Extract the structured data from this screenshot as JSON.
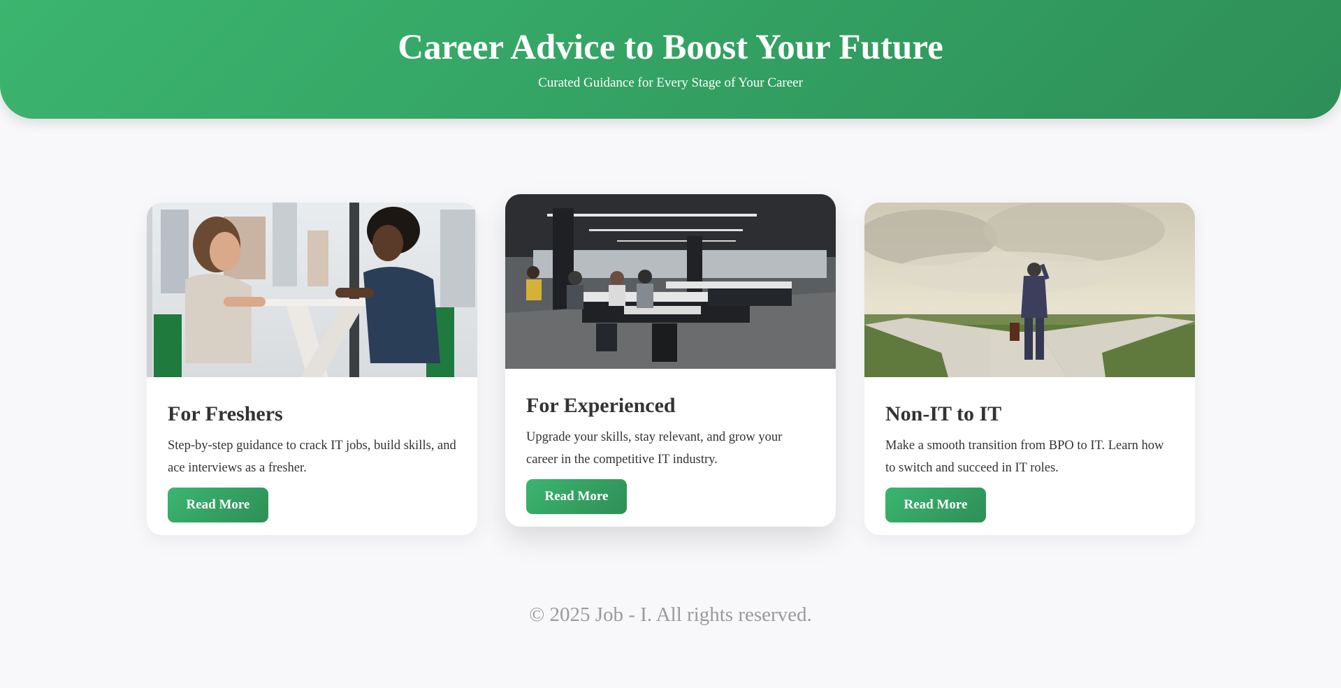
{
  "hero": {
    "title": "Career Advice to Boost Your Future",
    "subtitle": "Curated Guidance for Every Stage of Your Career",
    "gradient_start": "#3bb56f",
    "gradient_end": "#2e8f57"
  },
  "cards": [
    {
      "title": "For Freshers",
      "description": "Step-by-step guidance to crack IT jobs, build skills, and ace interviews as a fresher.",
      "button_label": "Read More",
      "image": "two-women-interview-photo"
    },
    {
      "title": "For Experienced",
      "description": "Upgrade your skills, stay relevant, and grow your career in the competitive IT industry.",
      "button_label": "Read More",
      "image": "open-office-workspace-photo"
    },
    {
      "title": "Non-IT to IT",
      "description": "Make a smooth transition from BPO to IT. Learn how to switch and succeed in IT roles.",
      "button_label": "Read More",
      "image": "crossroads-businessman-photo"
    }
  ],
  "footer": {
    "copyright": "© 2025 Job - I. All rights reserved."
  }
}
